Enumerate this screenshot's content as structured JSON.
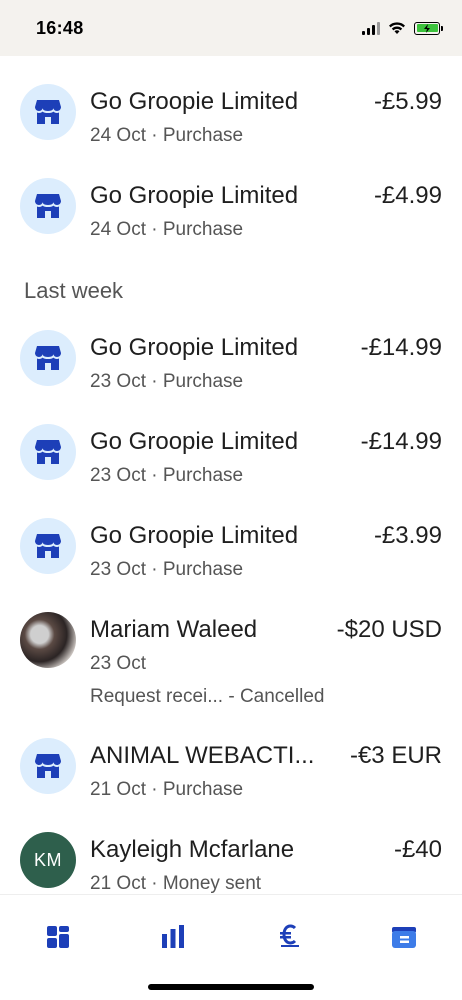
{
  "status_bar": {
    "time": "16:48"
  },
  "transactions_top": [
    {
      "name": "Go Groopie Limited",
      "amount": "-£5.99",
      "meta": "24 Oct · Purchase"
    },
    {
      "name": "Go Groopie Limited",
      "amount": "-£4.99",
      "meta": "24 Oct · Purchase"
    }
  ],
  "section": {
    "last_week": "Last week"
  },
  "transactions_last_week": [
    {
      "name": "Go Groopie Limited",
      "amount": "-£14.99",
      "meta": "23 Oct · Purchase"
    },
    {
      "name": "Go Groopie Limited",
      "amount": "-£14.99",
      "meta": "23 Oct · Purchase"
    },
    {
      "name": "Go Groopie Limited",
      "amount": "-£3.99",
      "meta": "23 Oct · Purchase"
    },
    {
      "name": "Mariam Waleed",
      "amount": "-$20 USD",
      "meta": "23 Oct",
      "status": "Request recei... - Cancelled"
    },
    {
      "name": "ANIMAL WEBACTI...",
      "amount": "-€3 EUR",
      "meta": "21 Oct · Purchase"
    },
    {
      "name": "Kayleigh Mcfarlane",
      "amount": "-£40",
      "meta": "21 Oct · Money sent",
      "initials": "KM"
    }
  ],
  "colors": {
    "brand_blue": "#1d3fb8",
    "avatar_bg": "#dcedfd",
    "initials_bg": "#2e5f4c",
    "battery_green": "#3cc23c"
  },
  "tab_bar": {
    "icons": [
      "dashboard-icon",
      "chart-icon",
      "currency-icon",
      "wallet-icon"
    ]
  }
}
